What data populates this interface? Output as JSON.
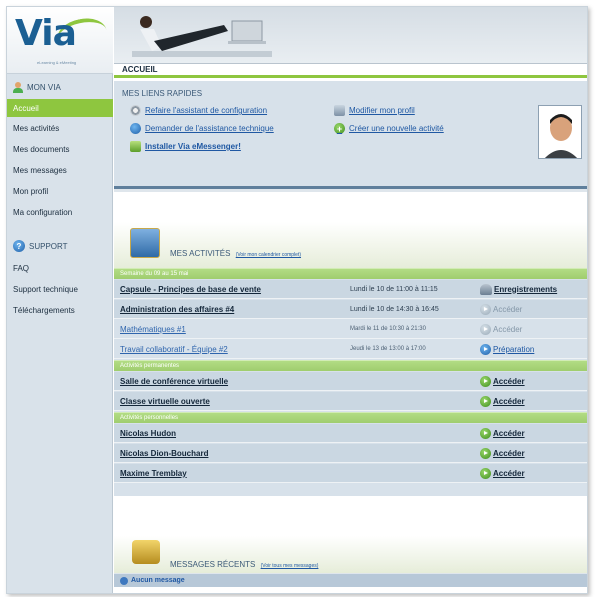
{
  "logo": {
    "brand": "Via",
    "tagline": "eLearning & eMeeting"
  },
  "header": {
    "section_title": "ACCUEIL"
  },
  "sidebar": {
    "mon_via": {
      "title": "MON VIA",
      "items": [
        "Accueil",
        "Mes activités",
        "Mes documents",
        "Mes messages",
        "Mon profil",
        "Ma configuration"
      ]
    },
    "support": {
      "title": "SUPPORT",
      "items": [
        "FAQ",
        "Support technique",
        "Téléchargements"
      ]
    }
  },
  "quick_links": {
    "title": "MES LIENS RAPIDES",
    "left": [
      "Refaire l'assistant de configuration",
      "Demander de l'assistance technique",
      "Installer Via eMessenger!"
    ],
    "right": [
      "Modifier mon profil",
      "Créer une nouvelle activité"
    ]
  },
  "activities": {
    "title": "MES ACTIVITÉS",
    "calendar_link": "(Voir mon calendrier complet)",
    "week_label": "Semaine du 09 au 15 mai",
    "scheduled": [
      {
        "name": "Capsule - Principes de base de vente",
        "date": "Lundi le 10 de 11:00 à 11:15",
        "action": "Enregistrements"
      },
      {
        "name": "Administration des affaires #4",
        "date": "Lundi le 10 de 14:30 à 16:45",
        "action": "Accéder"
      },
      {
        "name": "Mathématiques #1",
        "date": "Mardi le 11 de 10:30 à 21:30",
        "action": "Accéder"
      },
      {
        "name": "Travail collaboratif - Équipe #2",
        "date": "Jeudi le 13 de 13:00 à 17:00",
        "action": "Préparation"
      }
    ],
    "permanent_label": "Activités permanentes",
    "permanent": [
      {
        "name": "Salle de conférence virtuelle",
        "action": "Accéder"
      },
      {
        "name": "Classe virtuelle ouverte",
        "action": "Accéder"
      }
    ],
    "personal_label": "Activités personnelles",
    "personal": [
      {
        "name": "Nicolas Hudon",
        "action": "Accéder"
      },
      {
        "name": "Nicolas Dion-Bouchard",
        "action": "Accéder"
      },
      {
        "name": "Maxime Tremblay",
        "action": "Accéder"
      }
    ]
  },
  "messages": {
    "title": "MESSAGES RÉCENTS",
    "link": "(Voir tous mes messages)",
    "empty": "Aucun message"
  }
}
